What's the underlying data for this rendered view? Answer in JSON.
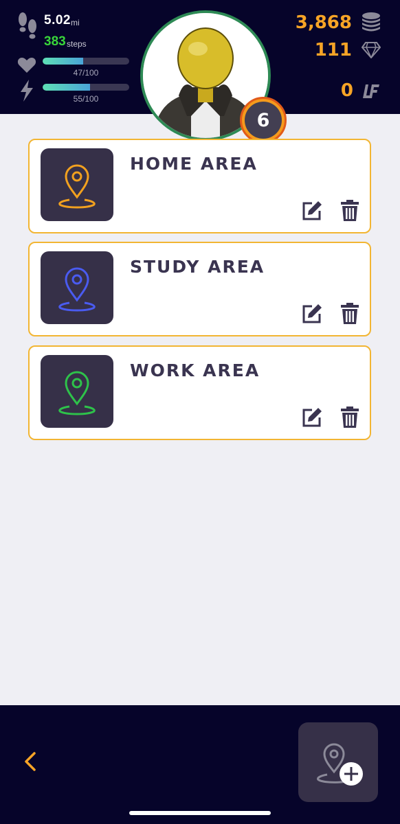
{
  "header": {
    "distance": {
      "value": "5.02",
      "unit": "mi",
      "icon": "footprints-icon"
    },
    "steps": {
      "value": "383",
      "unit": "steps"
    },
    "health": {
      "label": "47/100",
      "fraction": 0.47,
      "icon": "heart-icon"
    },
    "energy": {
      "label": "55/100",
      "fraction": 0.55,
      "icon": "lightning-icon"
    },
    "avatar": {
      "icon": "avatar-character"
    },
    "level": "6",
    "coins": {
      "value": "3,868",
      "icon": "coins-stack-icon"
    },
    "gems": {
      "value": "111",
      "icon": "diamond-icon"
    },
    "tokens": {
      "value": "0",
      "icon": "lf-token-icon"
    }
  },
  "areas": [
    {
      "title": "HOME AREA",
      "color": "#f2a11f",
      "icon": "location-pin-icon"
    },
    {
      "title": "STUDY AREA",
      "color": "#4a5bf0",
      "icon": "location-pin-icon"
    },
    {
      "title": "WORK AREA",
      "color": "#2ec24a",
      "icon": "location-pin-icon"
    }
  ],
  "card_actions": {
    "edit_icon": "edit-icon",
    "delete_icon": "trash-icon"
  },
  "footer": {
    "back_icon": "chevron-left-icon",
    "add_icon": "add-location-icon",
    "accent": "#f6a426"
  },
  "colors": {
    "dark": "#06042a",
    "card_border": "#f2b532",
    "orange": "#f6a426"
  }
}
